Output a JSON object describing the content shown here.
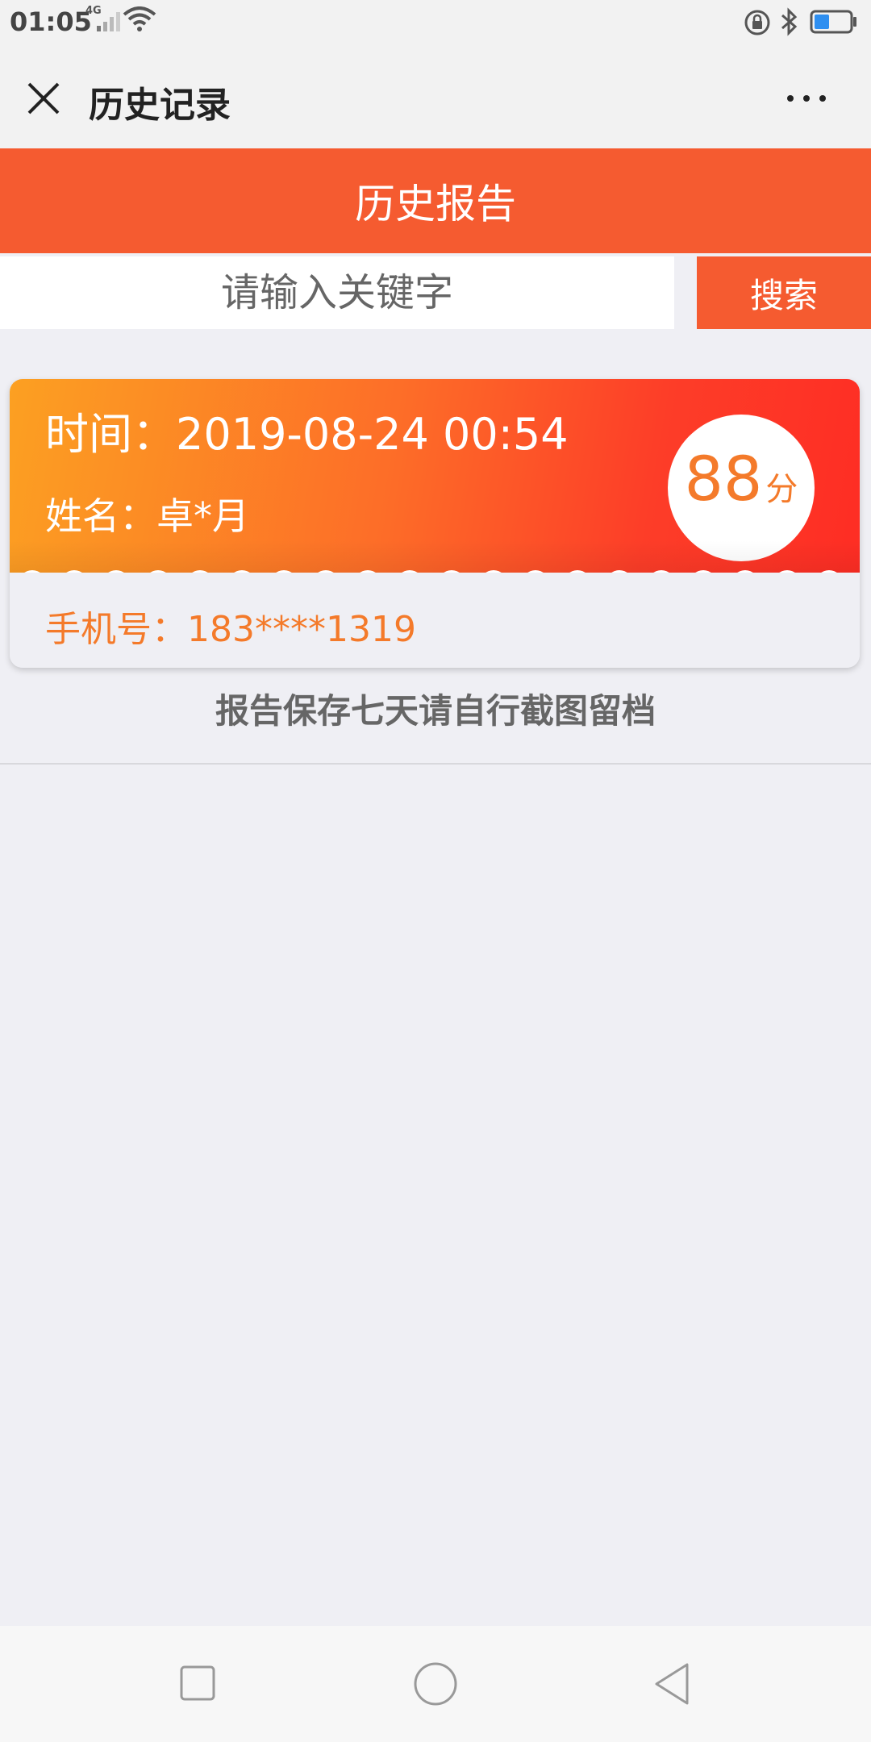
{
  "status_bar": {
    "time": "01:05",
    "network": "4G"
  },
  "title_bar": {
    "title": "历史记录"
  },
  "header": {
    "title": "历史报告"
  },
  "search": {
    "placeholder": "请输入关键字",
    "button_label": "搜索"
  },
  "report": {
    "time": "时间：2019-08-24 00:54",
    "name": "姓名：卓*月",
    "score": "88",
    "score_unit": "分",
    "phone": "手机号：183****1319"
  },
  "notice": "报告保存七天请自行截图留档",
  "colors": {
    "accent": "#f55b30",
    "card_gradient_start": "#fca022",
    "card_gradient_end": "#fe2d24",
    "score_text": "#f47a2a",
    "background": "#efeff4"
  }
}
